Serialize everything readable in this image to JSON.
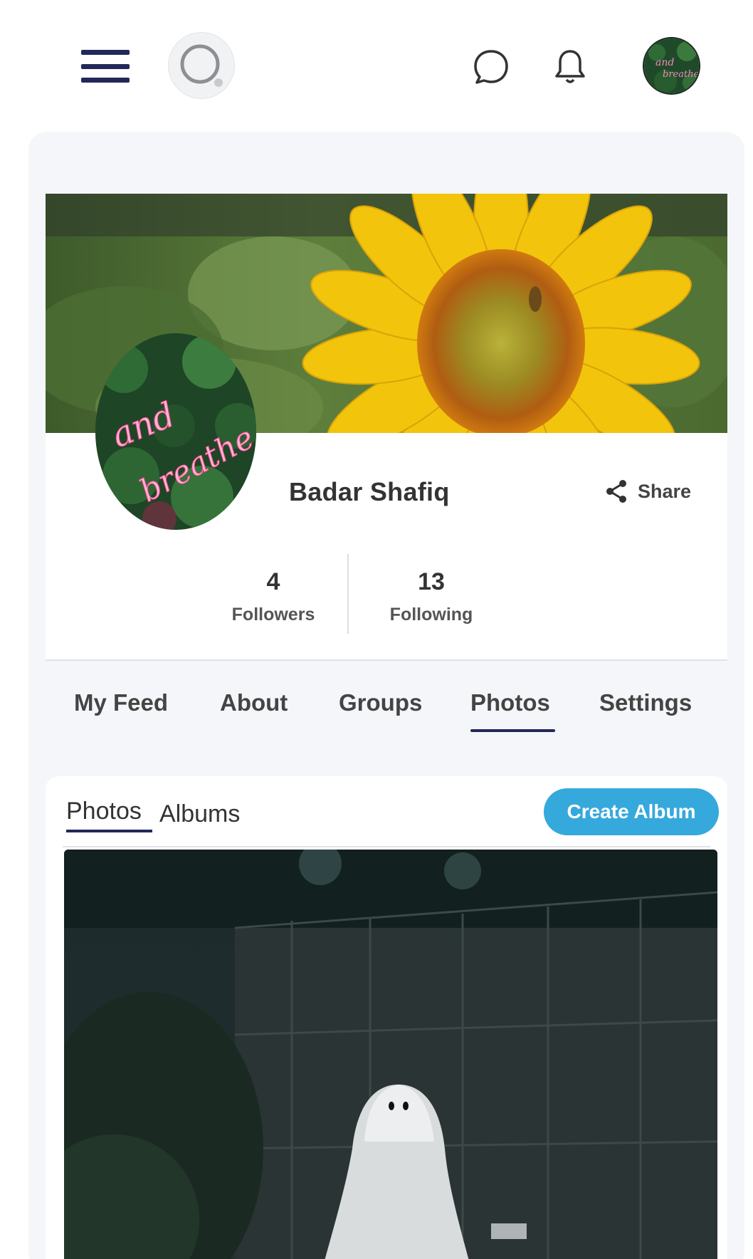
{
  "topbar": {
    "menu_icon": "hamburger-menu-icon",
    "search_icon": "search-icon",
    "chat_icon": "chat-bubble-icon",
    "notification_icon": "bell-icon",
    "avatar_icon": "user-avatar"
  },
  "profile": {
    "name": "Badar Shafiq",
    "share_label": "Share",
    "share_icon": "share-icon",
    "followers_count": "4",
    "followers_label": "Followers",
    "following_count": "13",
    "following_label": "Following"
  },
  "tabs": [
    {
      "label": "My Feed",
      "active": false
    },
    {
      "label": "About",
      "active": false
    },
    {
      "label": "Groups",
      "active": false
    },
    {
      "label": "Photos",
      "active": true
    },
    {
      "label": "Settings",
      "active": false
    }
  ],
  "photos_section": {
    "subtabs": [
      {
        "label": "Photos",
        "active": true
      },
      {
        "label": "Albums",
        "active": false
      }
    ],
    "create_album_label": "Create Album"
  },
  "colors": {
    "accent_navy": "#23285a",
    "button_blue": "#35a9dc",
    "panel_bg": "#f5f6f9"
  }
}
